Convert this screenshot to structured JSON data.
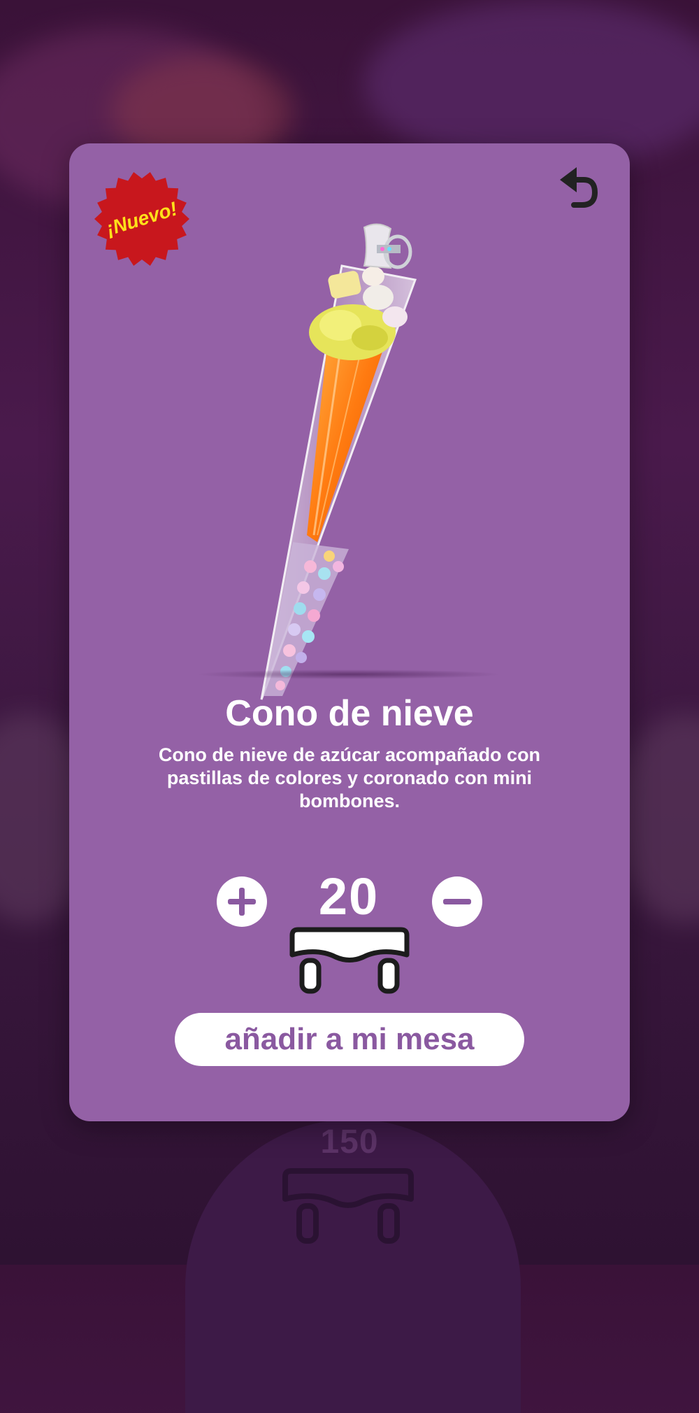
{
  "background": {
    "quantity": "150"
  },
  "product": {
    "badge": "¡Nuevo!",
    "title": "Cono de nieve",
    "description": "Cono de nieve de azúcar acompañado con pastillas de colores y coronado con mini bombones.",
    "quantity": "20",
    "image": "cono-de-nieve-candy-bag"
  },
  "actions": {
    "back_icon": "undo-arrow-icon",
    "add_label": "añadir a mi mesa",
    "plus_icon": "plus-icon",
    "minus_icon": "minus-icon",
    "table_icon": "table-icon"
  },
  "colors": {
    "card": "#9461a6",
    "badge": "#c8171d",
    "badge_text": "#ffe11a",
    "button_text": "#8a59a0"
  }
}
